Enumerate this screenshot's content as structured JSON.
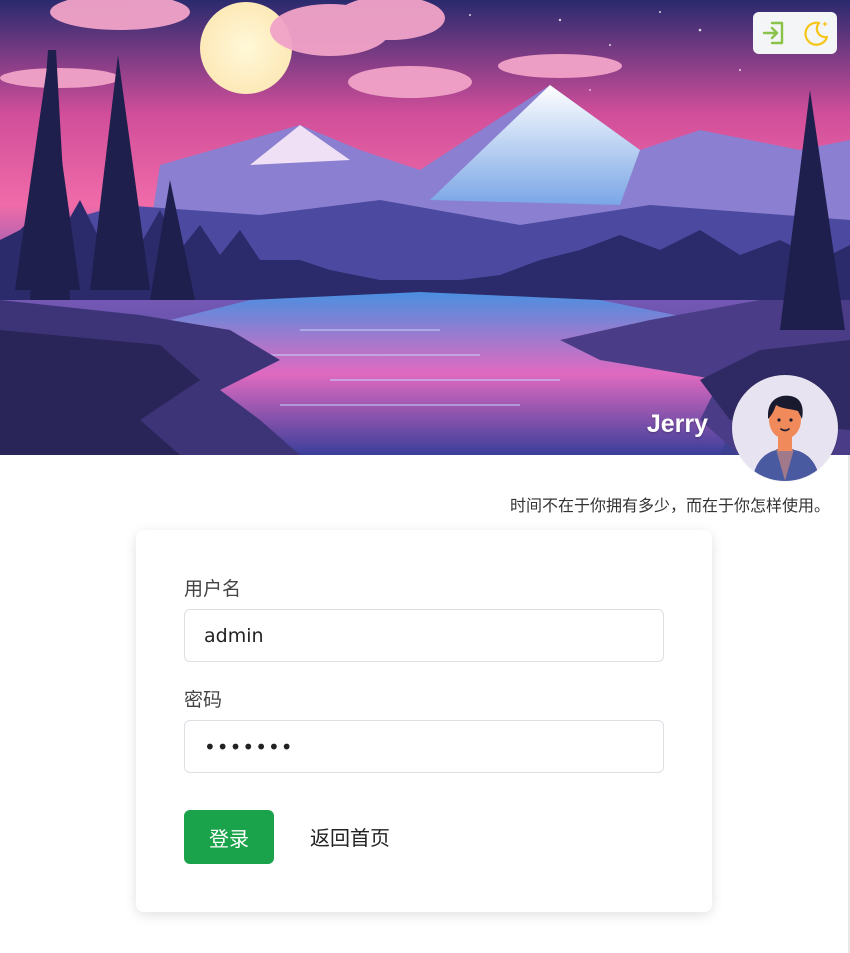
{
  "header": {
    "user_name": "Jerry",
    "motto": "时间不在于你拥有多少，而在于你怎样使用。",
    "actions": [
      {
        "icon": "login-icon",
        "color": "#8bc34a"
      },
      {
        "icon": "dark-mode-moon-icon",
        "color": "#f5c518"
      }
    ]
  },
  "login_form": {
    "username_label": "用户名",
    "username_value": "admin",
    "password_label": "密码",
    "password_value": "•••••••",
    "login_button": "登录",
    "home_link": "返回首页"
  },
  "colors": {
    "primary_button": "#1aa34a",
    "card_background": "#ffffff",
    "page_background": "#ffffff"
  }
}
